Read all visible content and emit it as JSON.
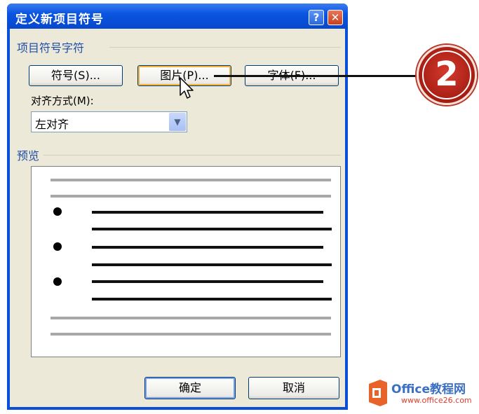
{
  "dialog": {
    "title": "定义新项目符号",
    "help_glyph": "?",
    "close_glyph": "✕"
  },
  "bullet_char_group": {
    "label": "项目符号字符",
    "symbol_button": "符号(S)...",
    "picture_button": "图片(P)...",
    "font_button": "字体(F)..."
  },
  "alignment": {
    "label": "对齐方式(M):",
    "selected": "左对齐"
  },
  "preview": {
    "label": "预览"
  },
  "footer": {
    "ok_button": "确定",
    "cancel_button": "取消"
  },
  "annotation": {
    "step_number": "2",
    "color": "#c0261a"
  },
  "watermark": {
    "line1": "Office教程网",
    "line2": "www.office26.com"
  },
  "colors": {
    "titlebar": "#0a55e0",
    "client": "#ece9d8",
    "group_label": "#1f4ea8"
  }
}
